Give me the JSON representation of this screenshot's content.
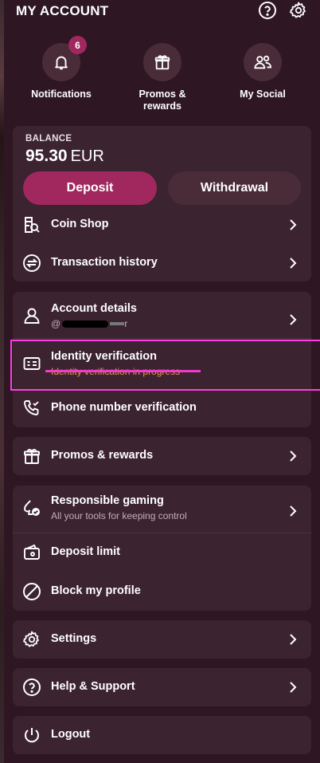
{
  "header": {
    "title": "MY ACCOUNT"
  },
  "quick_actions": [
    {
      "label": "Notifications",
      "icon": "bell-icon",
      "badge": "6"
    },
    {
      "label": "Promos &\nrewards",
      "icon": "gift-icon"
    },
    {
      "label": "My Social",
      "icon": "people-icon"
    }
  ],
  "balance": {
    "label": "BALANCE",
    "amount": "95.30",
    "currency": "EUR",
    "deposit_label": "Deposit",
    "withdrawal_label": "Withdrawal"
  },
  "wallet_menu": [
    {
      "label": "Coin Shop",
      "icon": "coin-shop-icon"
    },
    {
      "label": "Transaction history",
      "icon": "exchange-icon"
    }
  ],
  "account_menu": {
    "account_details": {
      "label": "Account details",
      "sub": "@",
      "sub_tail": "r"
    },
    "identity_verification": {
      "label": "Identity verification",
      "sub": "Identity verification in progress"
    },
    "phone_verification": {
      "label": "Phone number verification"
    }
  },
  "promos": {
    "label": "Promos & rewards"
  },
  "responsible": {
    "responsible_gaming": {
      "label": "Responsible gaming",
      "sub": "All your tools for keeping control"
    },
    "deposit_limit": {
      "label": "Deposit limit"
    },
    "block_profile": {
      "label": "Block my profile"
    }
  },
  "settings": {
    "label": "Settings"
  },
  "help": {
    "label": "Help & Support"
  },
  "logout": {
    "label": "Logout"
  },
  "colors": {
    "background": "#2e1622",
    "card": "#3c2330",
    "deposit_button": "#a0285f",
    "withdrawal_button": "#4a2c39",
    "highlight": "#ff3ce9"
  }
}
